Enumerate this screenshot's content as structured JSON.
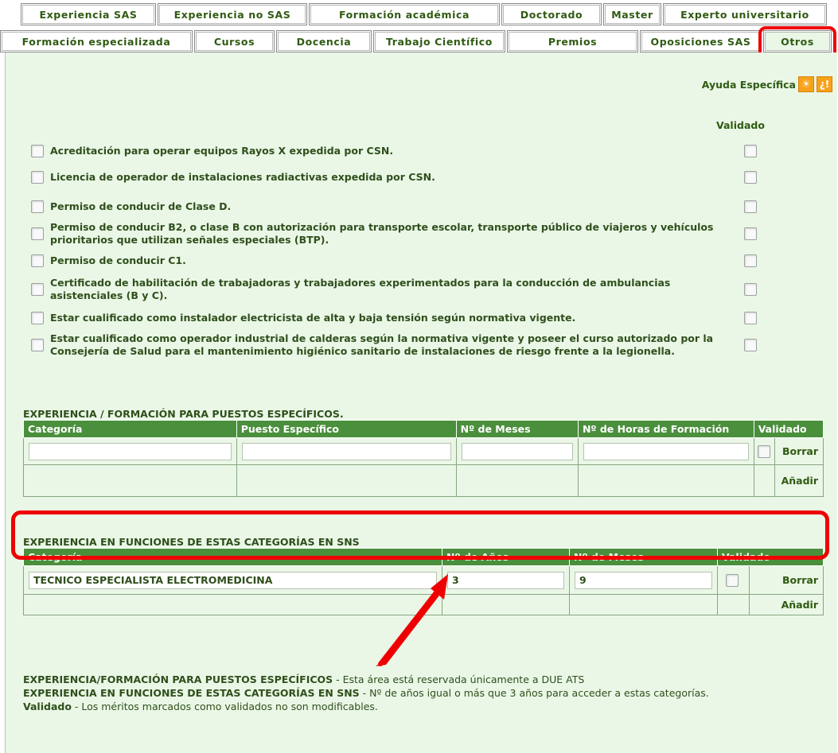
{
  "tabs_row1": [
    "Experiencia SAS",
    "Experiencia no SAS",
    "Formación académica",
    "Doctorado",
    "Master",
    "Experto universitario"
  ],
  "tabs_row2": [
    "Formación especializada",
    "Cursos",
    "Docencia",
    "Trabajo Científico",
    "Premios",
    "Oposiciones SAS",
    "Otros"
  ],
  "help": {
    "label": "Ayuda Específica",
    "icon1": "bulb-icon",
    "icon2": "question-icon"
  },
  "validado_header": "Validado",
  "checks": [
    "Acreditación para operar equipos Rayos X expedida por CSN.",
    "Licencia de operador de instalaciones radiactivas expedida por CSN.",
    "Permiso de conducir de Clase D.",
    "Permiso de conducir B2, o clase B con autorización para transporte escolar, transporte público de viajeros y vehículos prioritarios que utilizan señales especiales (BTP).",
    "Permiso de conducir C1.",
    "Certificado de habilitación de trabajadoras y trabajadores experimentados para la conducción de ambulancias asistenciales (B y C).",
    "Estar cualificado como instalador electricista de alta y baja tensión según normativa vigente.",
    "Estar cualificado como operador industrial de calderas según la normativa vigente y poseer el curso autorizado por la Consejería de Salud para el mantenimiento higiénico sanitario de instalaciones de riesgo frente a la legionella."
  ],
  "section1": {
    "title": "EXPERIENCIA / FORMACIÓN PARA PUESTOS ESPECÍFICOS.",
    "headers": [
      "Categoría",
      "Puesto Específico",
      "Nº de Meses",
      "Nº de Horas de Formación",
      "Validado"
    ],
    "row": {
      "categoria": "",
      "puesto": "",
      "meses": "",
      "horas": ""
    },
    "delete": "Borrar",
    "add": "Añadir"
  },
  "section2": {
    "title": "EXPERIENCIA EN FUNCIONES DE ESTAS CATEGORÍAS EN SNS",
    "headers": [
      "Categoría",
      "Nº de Años",
      "Nº de Meses",
      "Validado"
    ],
    "row": {
      "categoria": "TECNICO ESPECIALISTA ELECTROMEDICINA",
      "anios": "3",
      "meses": "9"
    },
    "delete": "Borrar",
    "add": "Añadir"
  },
  "legend": {
    "l1_bold": "EXPERIENCIA/FORMACIÓN PARA PUESTOS ESPECÍFICOS",
    "l1_text": " - Esta área está reservada únicamente a DUE ATS",
    "l2_bold": "EXPERIENCIA EN FUNCIONES DE ESTAS CATEGORÍAS EN SNS",
    "l2_text": " - Nº de años igual o más que 3 años para acceder a estas categorías.",
    "l3_bold": "Validado",
    "l3_text": " - Los méritos marcados como validados no son modificables."
  },
  "colors": {
    "accent_green": "#4a8f3c",
    "panel_bg": "#eaf7e6",
    "highlight_red": "#ef0000"
  }
}
